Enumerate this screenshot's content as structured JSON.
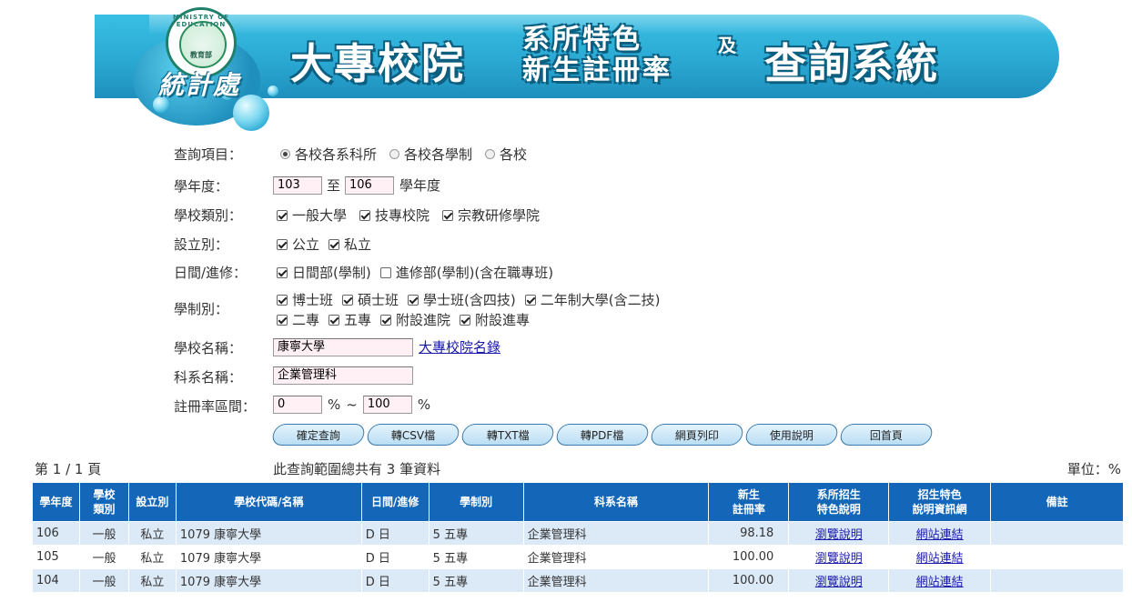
{
  "banner": {
    "seal_ring_text": "MINISTRY OF EDUCATION",
    "seal_center_text": "教育部",
    "dept": "統計處",
    "title_part1": "大專校院",
    "title_part2a": "系所特色",
    "title_part2b": "新生註冊率",
    "title_part3": "及",
    "title_part4": "查詢系統"
  },
  "form": {
    "query_item": {
      "label": "查詢項目：",
      "options": [
        {
          "label": "各校各系科所",
          "selected": true
        },
        {
          "label": "各校各學制",
          "selected": false
        },
        {
          "label": "各校",
          "selected": false
        }
      ]
    },
    "year": {
      "label": "學年度：",
      "from": "103",
      "to_text": "至",
      "to": "106",
      "suffix": "學年度"
    },
    "school_type": {
      "label": "學校類別：",
      "options": [
        {
          "label": "一般大學",
          "checked": true
        },
        {
          "label": "技專校院",
          "checked": true
        },
        {
          "label": "宗教研修學院",
          "checked": true
        }
      ]
    },
    "establish": {
      "label": "設立別：",
      "options": [
        {
          "label": "公立",
          "checked": true
        },
        {
          "label": "私立",
          "checked": true
        }
      ]
    },
    "day_night": {
      "label": "日間/進修：",
      "options": [
        {
          "label": "日間部(學制)",
          "checked": true
        },
        {
          "label": "進修部(學制)(含在職專班)",
          "checked": false
        }
      ]
    },
    "system": {
      "label": "學制別：",
      "row1": [
        {
          "label": "博士班",
          "checked": true
        },
        {
          "label": "碩士班",
          "checked": true
        },
        {
          "label": "學士班(含四技)",
          "checked": true
        },
        {
          "label": "二年制大學(含二技)",
          "checked": true
        }
      ],
      "row2": [
        {
          "label": "二專",
          "checked": true
        },
        {
          "label": "五專",
          "checked": true
        },
        {
          "label": "附設進院",
          "checked": true
        },
        {
          "label": "附設進專",
          "checked": true
        }
      ]
    },
    "school_name": {
      "label": "學校名稱：",
      "value": "康寧大學",
      "link": "大專校院名錄"
    },
    "dept_name": {
      "label": "科系名稱：",
      "value": "企業管理科"
    },
    "rate_range": {
      "label": "註冊率區間：",
      "min": "0",
      "pct1": "%",
      "tilde": "~",
      "max": "100",
      "pct2": "%"
    }
  },
  "buttons": [
    "確定查詢",
    "轉CSV檔",
    "轉TXT檔",
    "轉PDF檔",
    "網頁列印",
    "使用說明",
    "回首頁"
  ],
  "status": {
    "page": "第 1 / 1 頁",
    "count": "此查詢範圍總共有 3 筆資料",
    "unit": "單位：%"
  },
  "table": {
    "headers": [
      "學年度",
      "學校\n類別",
      "設立別",
      "學校代碼/名稱",
      "日間/進修",
      "學制別",
      "科系名稱",
      "新生\n註冊率",
      "系所招生\n特色說明",
      "招生特色\n說明資訊網",
      "備註"
    ],
    "rows": [
      {
        "year": "106",
        "type": "一般",
        "est": "私立",
        "school": "1079 康寧大學",
        "dn": "D 日",
        "sys": "5 五專",
        "dept": "企業管理科",
        "rate": "98.18",
        "desc": "瀏覽說明",
        "web": "網站連結",
        "note": ""
      },
      {
        "year": "105",
        "type": "一般",
        "est": "私立",
        "school": "1079 康寧大學",
        "dn": "D 日",
        "sys": "5 五專",
        "dept": "企業管理科",
        "rate": "100.00",
        "desc": "瀏覽說明",
        "web": "網站連結",
        "note": ""
      },
      {
        "year": "104",
        "type": "一般",
        "est": "私立",
        "school": "1079 康寧大學",
        "dn": "D 日",
        "sys": "5 五專",
        "dept": "企業管理科",
        "rate": "100.00",
        "desc": "瀏覽說明",
        "web": "網站連結",
        "note": ""
      }
    ]
  }
}
